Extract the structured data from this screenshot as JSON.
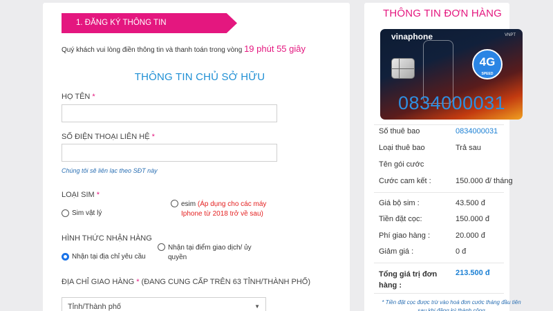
{
  "step": {
    "label": "1. ĐĂNG KÝ THÔNG TIN"
  },
  "notice": {
    "text": "Quý khách vui lòng điền thông tin và thanh toán trong vòng",
    "timer": "19 phút 55 giây"
  },
  "owner_section": {
    "title": "THÔNG TIN CHỦ SỞ HỮU"
  },
  "fields": {
    "full_name": {
      "label": "HỌ TÊN",
      "required_mark": "*",
      "value": ""
    },
    "phone": {
      "label": "SỐ ĐIỆN THOẠI LIÊN HỆ",
      "required_mark": "*",
      "value": "",
      "hint": "Chúng tôi sẽ liên lạc theo SĐT này"
    },
    "sim_type": {
      "label": "LOẠI SIM",
      "required_mark": "*",
      "options": [
        {
          "label": "Sim vật lý",
          "note": "",
          "selected": false
        },
        {
          "label": "esim",
          "note": "(Áp dụng cho các máy Iphone từ 2018 trở về sau)",
          "selected": false
        }
      ]
    },
    "delivery_method": {
      "label": "HÌNH THỨC NHẬN HÀNG",
      "options": [
        {
          "label": "Nhận tại địa chỉ yêu cầu",
          "selected": true
        },
        {
          "label": "Nhận tại điểm giao dịch/ ủy quyền",
          "selected": false
        }
      ]
    },
    "address": {
      "label": "ĐỊA CHỈ GIAO HÀNG",
      "required_mark": "*",
      "label_suffix": "(ĐANG CUNG CẤP TRÊN 63 TỈNH/THÀNH PHỐ)",
      "province_selected": "Tỉnh/Thành phố"
    }
  },
  "order": {
    "title": "THÔNG TIN ĐƠN HÀNG",
    "card": {
      "brand": "vinaphone",
      "partner": "VNPT",
      "badge": "4G",
      "badge_sub": "SPEED",
      "number": "0834000031"
    },
    "rows": [
      {
        "label": "Số thuê bao",
        "value": "0834000031"
      },
      {
        "label": "Loại thuê bao",
        "value": "Trả sau"
      },
      {
        "label": "Tên gói cước",
        "value": ""
      },
      {
        "label": "Cước cam kết :",
        "value": "150.000 đ/ tháng"
      },
      {
        "label": "Giá bộ sim :",
        "value": "43.500 đ"
      },
      {
        "label": "Tiền đặt cọc:",
        "value": "150.000 đ"
      },
      {
        "label": "Phí giao hàng :",
        "value": "20.000 đ"
      },
      {
        "label": "Giảm giá :",
        "value": "0 đ"
      }
    ],
    "total": {
      "label": "Tổng giá trị đơn hàng :",
      "value": "213.500 đ"
    },
    "footnote": "* Tiền đặt cọc được trừ vào hoá đơn cước tháng đầu tiên sau khi đăng ký thành công"
  },
  "colors": {
    "brand_pink": "#e4177f",
    "accent_blue": "#1e8fd4",
    "radio_blue": "#1a73e8",
    "warning_red": "#e42020"
  }
}
